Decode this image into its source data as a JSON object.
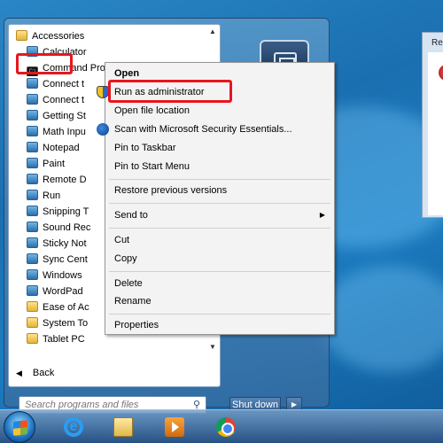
{
  "programs": {
    "items": [
      {
        "label": "Accessories",
        "icon": "folder-icon"
      },
      {
        "label": "Calculator",
        "icon": "calculator-icon"
      },
      {
        "label": "Command Prompt",
        "icon": "command-prompt-icon"
      },
      {
        "label": "Connect t",
        "icon": "network-icon"
      },
      {
        "label": "Connect t",
        "icon": "projector-icon"
      },
      {
        "label": "Getting St",
        "icon": "getting-started-icon"
      },
      {
        "label": "Math Inpu",
        "icon": "math-input-icon"
      },
      {
        "label": "Notepad",
        "icon": "notepad-icon"
      },
      {
        "label": "Paint",
        "icon": "paint-icon"
      },
      {
        "label": "Remote D",
        "icon": "remote-desktop-icon"
      },
      {
        "label": "Run",
        "icon": "run-icon"
      },
      {
        "label": "Snipping T",
        "icon": "snipping-tool-icon"
      },
      {
        "label": "Sound Rec",
        "icon": "sound-recorder-icon"
      },
      {
        "label": "Sticky Not",
        "icon": "sticky-notes-icon"
      },
      {
        "label": "Sync Cent",
        "icon": "sync-center-icon"
      },
      {
        "label": "Windows",
        "icon": "windows-explorer-icon"
      },
      {
        "label": "WordPad",
        "icon": "wordpad-icon"
      },
      {
        "label": "Ease of Ac",
        "icon": "folder-icon"
      },
      {
        "label": "System To",
        "icon": "folder-icon"
      },
      {
        "label": "Tablet PC",
        "icon": "folder-icon"
      }
    ],
    "back_label": "Back"
  },
  "search": {
    "placeholder": "Search programs and files"
  },
  "shutdown": {
    "label": "Shut down"
  },
  "context_menu": {
    "open": "Open",
    "run_as_admin": "Run as administrator",
    "open_file_location": "Open file location",
    "scan": "Scan with Microsoft Security Essentials...",
    "pin_taskbar": "Pin to Taskbar",
    "pin_start": "Pin to Start Menu",
    "restore": "Restore previous versions",
    "send_to": "Send to",
    "cut": "Cut",
    "copy": "Copy",
    "delete": "Delete",
    "rename": "Rename",
    "properties": "Properties"
  },
  "background_window": {
    "title": "Re"
  },
  "taskbar": {
    "icons": [
      "start-orb-icon",
      "internet-explorer-icon",
      "windows-explorer-icon",
      "media-player-icon",
      "chrome-icon"
    ]
  },
  "colors": {
    "highlight": "#e8161e",
    "accent": "#1c7cc0"
  }
}
